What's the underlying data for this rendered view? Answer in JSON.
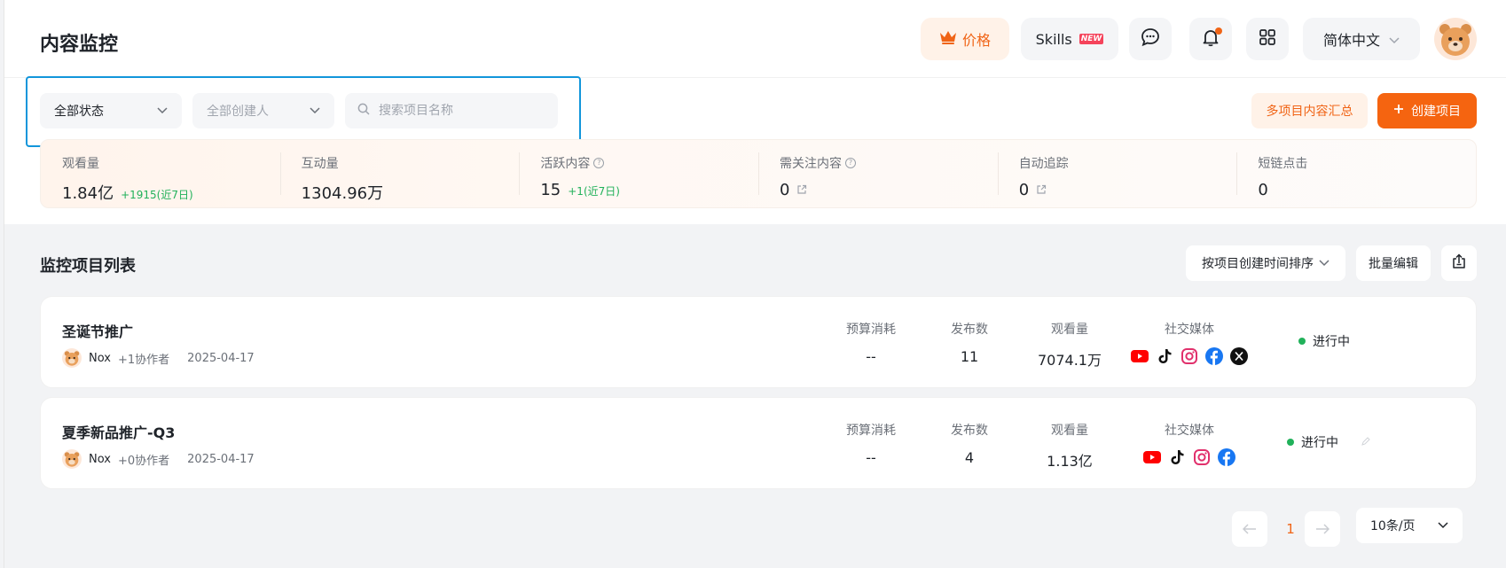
{
  "header": {
    "title": "内容监控",
    "price_label": "价格",
    "skills_label": "Skills",
    "skills_badge": "NEW",
    "language": "简体中文",
    "accent": "#f06416"
  },
  "filters": {
    "status": "全部状态",
    "creator_placeholder": "全部创建人",
    "search_placeholder": "搜索项目名称",
    "summary_label": "多项目内容汇总",
    "create_label": "创建项目"
  },
  "stats": [
    {
      "label": "观看量",
      "value": "1.84亿",
      "delta": "+1915(近7日)"
    },
    {
      "label": "互动量",
      "value": "1304.96万"
    },
    {
      "label": "活跃内容",
      "value": "15",
      "delta": "+1(近7日)",
      "help": "?"
    },
    {
      "label": "需关注内容",
      "value": "0",
      "help": "?"
    },
    {
      "label": "自动追踪",
      "value": "0"
    },
    {
      "label": "短链点击",
      "value": "0"
    }
  ],
  "list": {
    "title": "监控项目列表",
    "sort_label": "按项目创建时间排序",
    "batch_label": "批量编辑",
    "col_budget": "预算消耗",
    "col_posts": "发布数",
    "col_views": "观看量",
    "col_social": "社交媒体",
    "projects": [
      {
        "name": "圣诞节推广",
        "owner": "Nox",
        "collaborators": "+1协作者",
        "date": "2025-04-17",
        "budget": "--",
        "posts": "11",
        "views": "7074.1万",
        "social": [
          "youtube-icon",
          "tiktok-icon",
          "instagram-icon",
          "facebook-icon",
          "x-icon"
        ],
        "status": "进行中"
      },
      {
        "name": "夏季新品推广-Q3",
        "owner": "Nox",
        "collaborators": "+0协作者",
        "date": "2025-04-17",
        "budget": "--",
        "posts": "4",
        "views": "1.13亿",
        "social": [
          "youtube-icon",
          "tiktok-icon",
          "instagram-icon",
          "facebook-icon"
        ],
        "status": "进行中"
      }
    ]
  },
  "pagination": {
    "current": "1",
    "page_size": "10条/页"
  }
}
